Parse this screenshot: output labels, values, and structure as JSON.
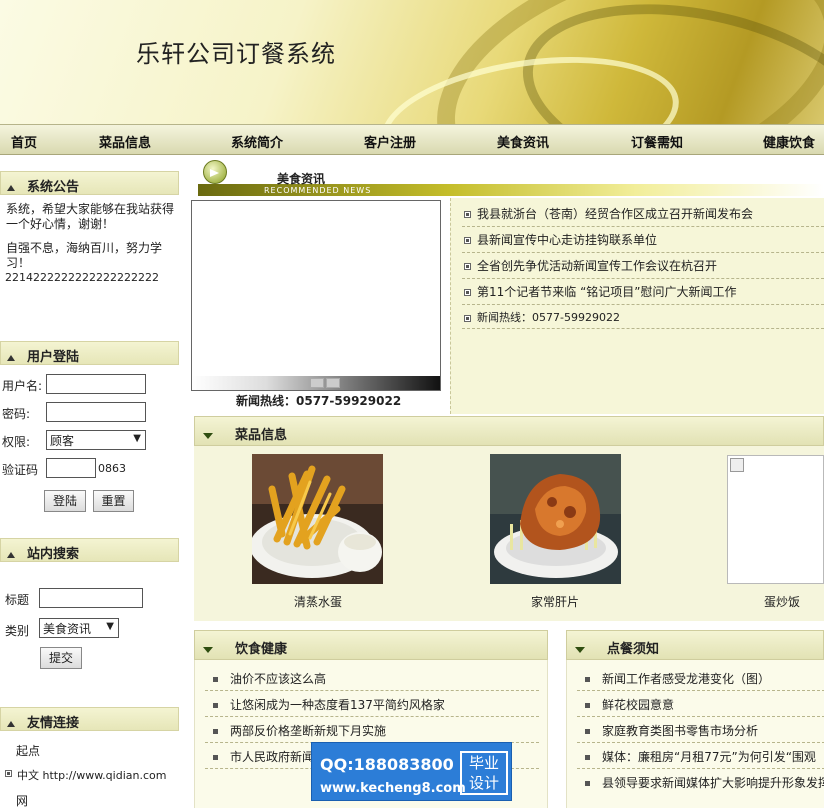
{
  "header": {
    "title": "乐轩公司订餐系统"
  },
  "nav": {
    "items": [
      "首页",
      "菜品信息",
      "系统简介",
      "客户注册",
      "美食资讯",
      "订餐需知",
      "健康饮食"
    ]
  },
  "notice": {
    "title": "系统公告",
    "line1": "系统，希望大家能够在我站获得一个好心情，谢谢！",
    "line2": "自强不息，海纳百川，努力学习！",
    "line3": "2214222222222222222222"
  },
  "login": {
    "title": "用户登陆",
    "username_label": "用户名:",
    "password_label": "密码:",
    "role_label": "权限:",
    "role_value": "顾客",
    "captcha_label": "验证码",
    "captcha_code": "0863",
    "login_button": "登陆",
    "reset_button": "重置"
  },
  "search": {
    "title": "站内搜索",
    "title_label": "标题",
    "category_label": "类别",
    "category_value": "美食资讯",
    "submit_button": "提交"
  },
  "links": {
    "title": "友情连接",
    "item1": "起点",
    "item2": "中文 http://www.qidian.com",
    "item3": "网"
  },
  "news": {
    "title": "美食资讯",
    "subtitle": "RECOMMENDED NEWS",
    "hotline_under": "新闻热线：0577-59929022",
    "items": [
      "我县就浙台（苍南）经贸合作区成立召开新闻发布会",
      "县新闻宣传中心走访挂钩联系单位",
      "全省创先争优活动新闻宣传工作会议在杭召开",
      "第11个记者节来临 “铭记项目”慰问广大新闻工作",
      "新闻热线：0577-59929022"
    ]
  },
  "dishes": {
    "title": "菜品信息",
    "items": [
      "清蒸水蛋",
      "家常肝片",
      "蛋炒饭"
    ]
  },
  "health": {
    "title": "饮食健康",
    "items": [
      "油价不应该这么高",
      "让悠闲成为一种态度看137平简约风格家",
      "两部反价格垄断新规下月实施",
      "市人民政府新闻"
    ]
  },
  "order_notice": {
    "title": "点餐须知",
    "items": [
      "新闻工作者感受龙港变化（图）",
      "鲜花校园意意",
      "家庭教育类图书零售市场分析",
      "媒体：廉租房“月租77元”为何引发“围观",
      "县领导要求新闻媒体扩大影响提升形象发挥"
    ]
  },
  "watermark": {
    "qq": "QQ:188083800",
    "site": "www.kecheng8.com",
    "tag1": "毕业",
    "tag2": "设计"
  }
}
